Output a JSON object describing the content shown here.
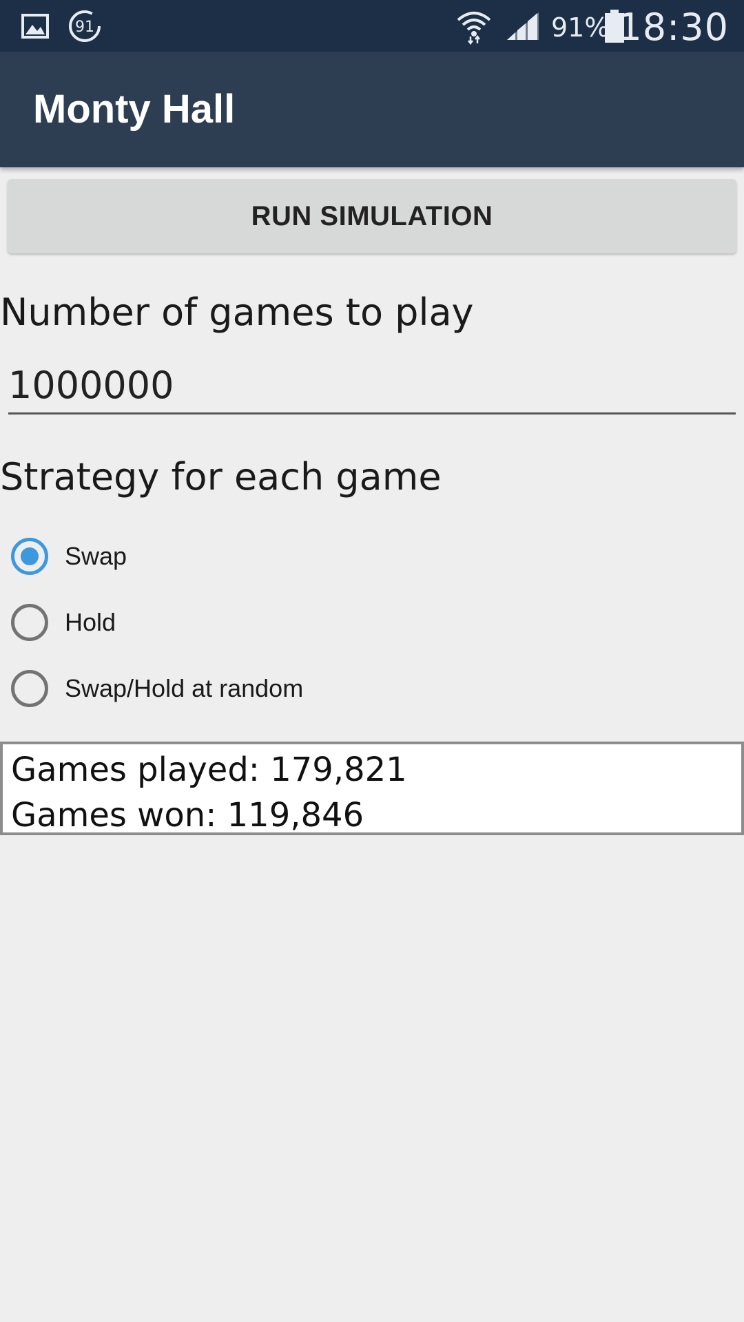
{
  "status_bar": {
    "battery_percent": "91%",
    "time": "18:30",
    "icons": [
      "gallery-icon",
      "badge-91-icon",
      "wifi-icon",
      "signal-icon",
      "battery-icon"
    ],
    "badge_text": "91",
    "background_color": "#1c2f46"
  },
  "app_bar": {
    "title": "Monty Hall",
    "background_color": "#2d3e52"
  },
  "main": {
    "run_button_label": "RUN SIMULATION",
    "games_label": "Number of games to play",
    "games_value": "1000000",
    "strategy_label": "Strategy for each game",
    "strategy_options": [
      {
        "label": "Swap",
        "checked": true
      },
      {
        "label": "Hold",
        "checked": false
      },
      {
        "label": "Swap/Hold at random",
        "checked": false
      }
    ],
    "accent_color": "#3d98de"
  },
  "results": {
    "games_played": "Games played: 179,821",
    "games_won": "Games won: 119,846"
  }
}
